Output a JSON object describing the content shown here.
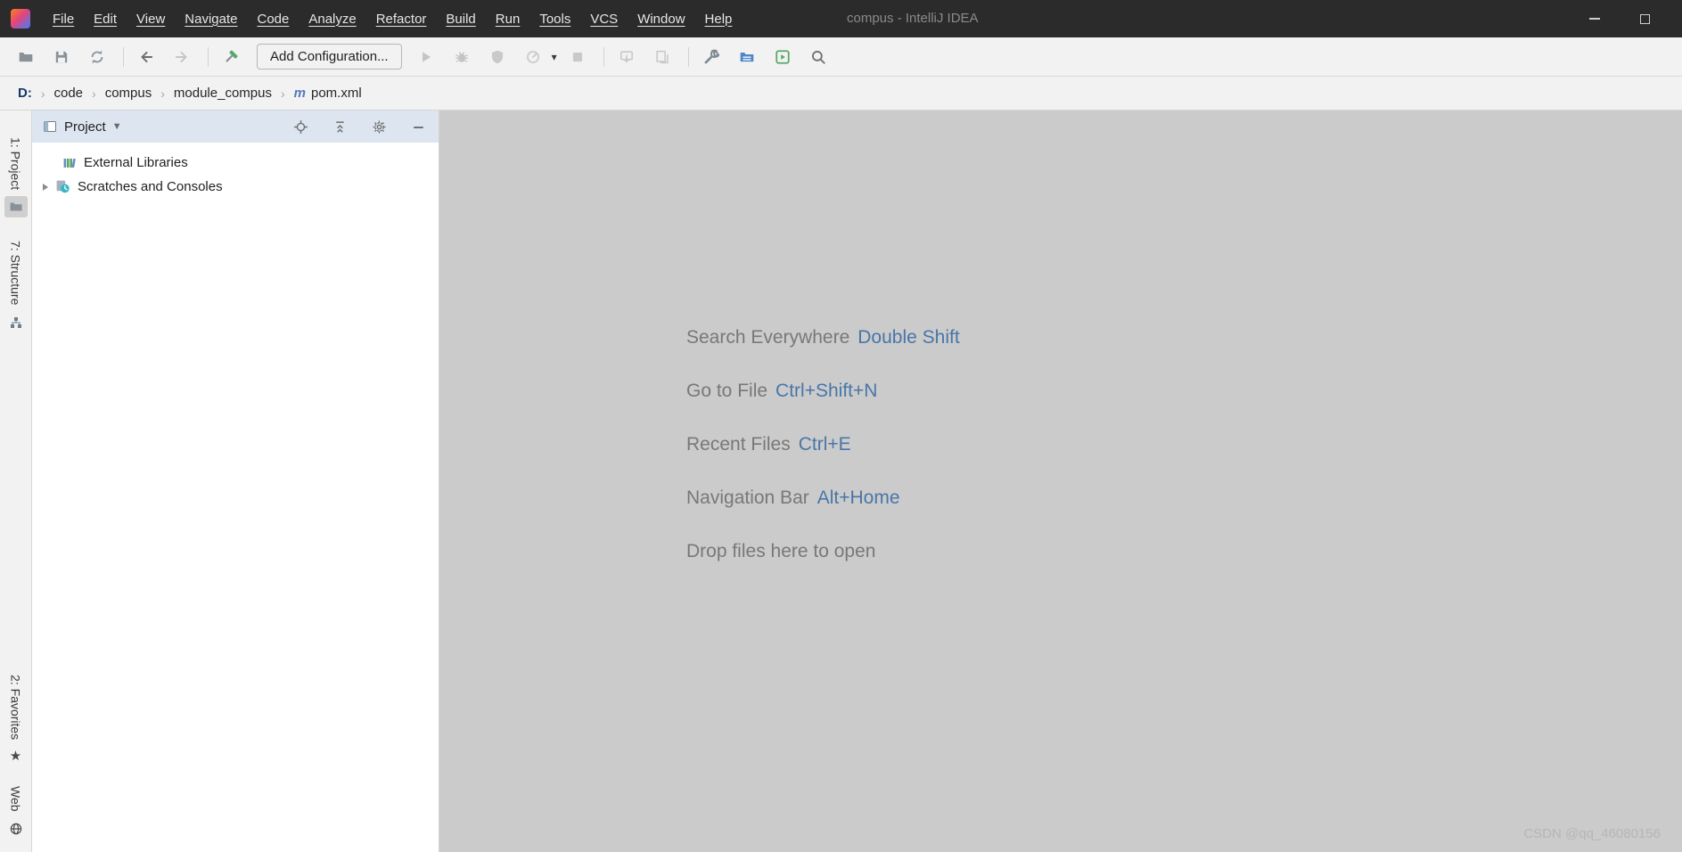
{
  "window": {
    "title": "compus - IntelliJ IDEA",
    "controls": [
      "minimize",
      "maximize"
    ]
  },
  "menu": {
    "items": [
      "File",
      "Edit",
      "View",
      "Navigate",
      "Code",
      "Analyze",
      "Refactor",
      "Build",
      "Run",
      "Tools",
      "VCS",
      "Window",
      "Help"
    ]
  },
  "toolbar": {
    "add_configuration": "Add Configuration...",
    "icons": [
      "open",
      "save-all",
      "synchronize",
      "back",
      "forward",
      "build-hammer",
      "run",
      "debug",
      "run-with-coverage",
      "profile",
      "run-dropdown",
      "stop",
      "update-application",
      "update-classes",
      "wrench",
      "project-structure",
      "run-window",
      "search"
    ]
  },
  "breadcrumbs": {
    "separator": "›",
    "items": [
      "D:",
      "code",
      "compus",
      "module_compus",
      "pom.xml"
    ]
  },
  "tool_stripe": {
    "top": [
      {
        "label": "1: Project",
        "icon": "folder-icon",
        "active": true
      },
      {
        "label": "7: Structure",
        "icon": "structure-icon",
        "active": false
      }
    ],
    "bottom": [
      {
        "label": "2: Favorites",
        "icon": "star-icon",
        "active": false
      },
      {
        "label": "Web",
        "icon": "globe-icon",
        "active": false
      }
    ]
  },
  "project_panel": {
    "title": "Project",
    "header_icons": [
      "locate",
      "collapse-all",
      "settings-gear",
      "hide"
    ],
    "tree": [
      {
        "label": "External Libraries",
        "icon": "libraries-icon",
        "expandable": false
      },
      {
        "label": "Scratches and Consoles",
        "icon": "scratches-icon",
        "expandable": true
      }
    ]
  },
  "editor": {
    "hints": [
      {
        "label": "Search Everywhere",
        "shortcut": "Double Shift"
      },
      {
        "label": "Go to File",
        "shortcut": "Ctrl+Shift+N"
      },
      {
        "label": "Recent Files",
        "shortcut": "Ctrl+E"
      },
      {
        "label": "Navigation Bar",
        "shortcut": "Alt+Home"
      },
      {
        "label": "Drop files here to open",
        "shortcut": ""
      }
    ],
    "watermark": "CSDN @qq_46080156"
  },
  "colors": {
    "titlebar_bg": "#2b2b2b",
    "toolbar_bg": "#f2f2f2",
    "panel_header_bg": "#dde6f0",
    "editor_bg": "#cbcbcb",
    "hint_label": "#787878",
    "hint_shortcut": "#4876a8",
    "accent_green": "#59a869"
  }
}
